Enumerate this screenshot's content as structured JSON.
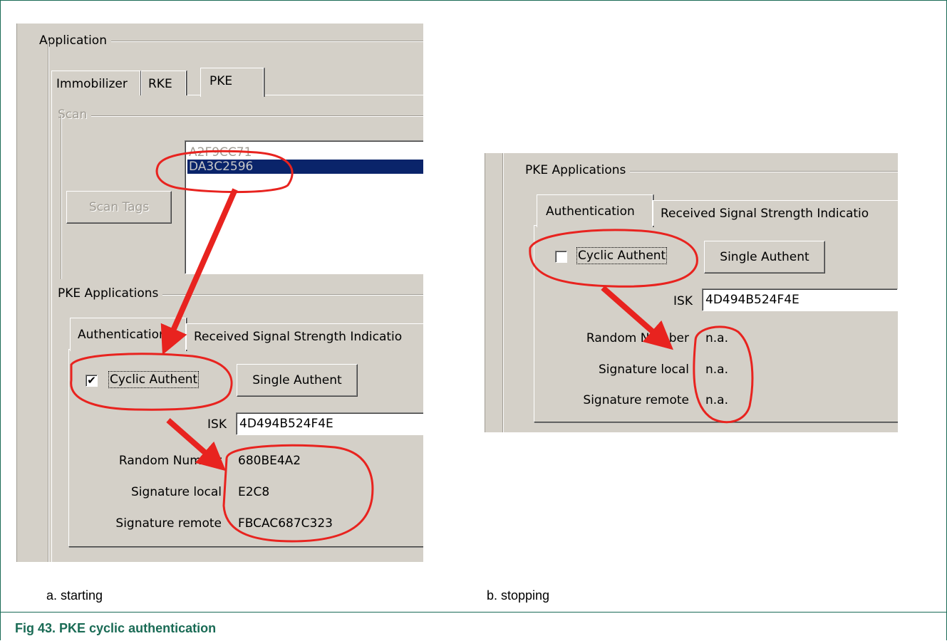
{
  "screenshot_a": {
    "application_group": "Application",
    "tabs": [
      "Immobilizer",
      "RKE",
      "PKE"
    ],
    "scan_group": "Scan",
    "tag_list": [
      "A2F9CC71",
      "DA3C2596"
    ],
    "scan_tags_button": "Scan Tags",
    "pke_applications_group": "PKE Applications",
    "sub_tabs": [
      "Authentication",
      "Received Signal Strength Indicatio"
    ],
    "cyclic_checkbox": {
      "label": "Cyclic Authent",
      "checked": true,
      "mark": "✔"
    },
    "single_authent_button": "Single Authent",
    "isk_label": "ISK",
    "isk_value": "4D494B524F4E",
    "random_number_label": "Random Number",
    "random_number_value": "680BE4A2",
    "signature_local_label": "Signature local",
    "signature_local_value": "E2C8",
    "signature_remote_label": "Signature remote",
    "signature_remote_value": "FBCAC687C323"
  },
  "screenshot_b": {
    "pke_applications_group": "PKE Applications",
    "sub_tabs": [
      "Authentication",
      "Received Signal Strength Indicatio"
    ],
    "cyclic_checkbox": {
      "label": "Cyclic Authent",
      "checked": false,
      "mark": ""
    },
    "single_authent_button": "Single Authent",
    "isk_label": "ISK",
    "isk_value": "4D494B524F4E",
    "random_number_label": "Random Number",
    "random_number_value": "n.a.",
    "signature_local_label": "Signature local",
    "signature_local_value": "n.a.",
    "signature_remote_label": "Signature remote",
    "signature_remote_value": "n.a."
  },
  "captions": {
    "a": "a.   starting",
    "b": "b.   stopping",
    "figure": "Fig 43.   PKE cyclic authentication"
  },
  "colors": {
    "dialog_gray": "#d4d0c8",
    "selection_blue": "#0a246a",
    "annotation_red": "#e8231f",
    "caption_green": "#1a6b55"
  }
}
